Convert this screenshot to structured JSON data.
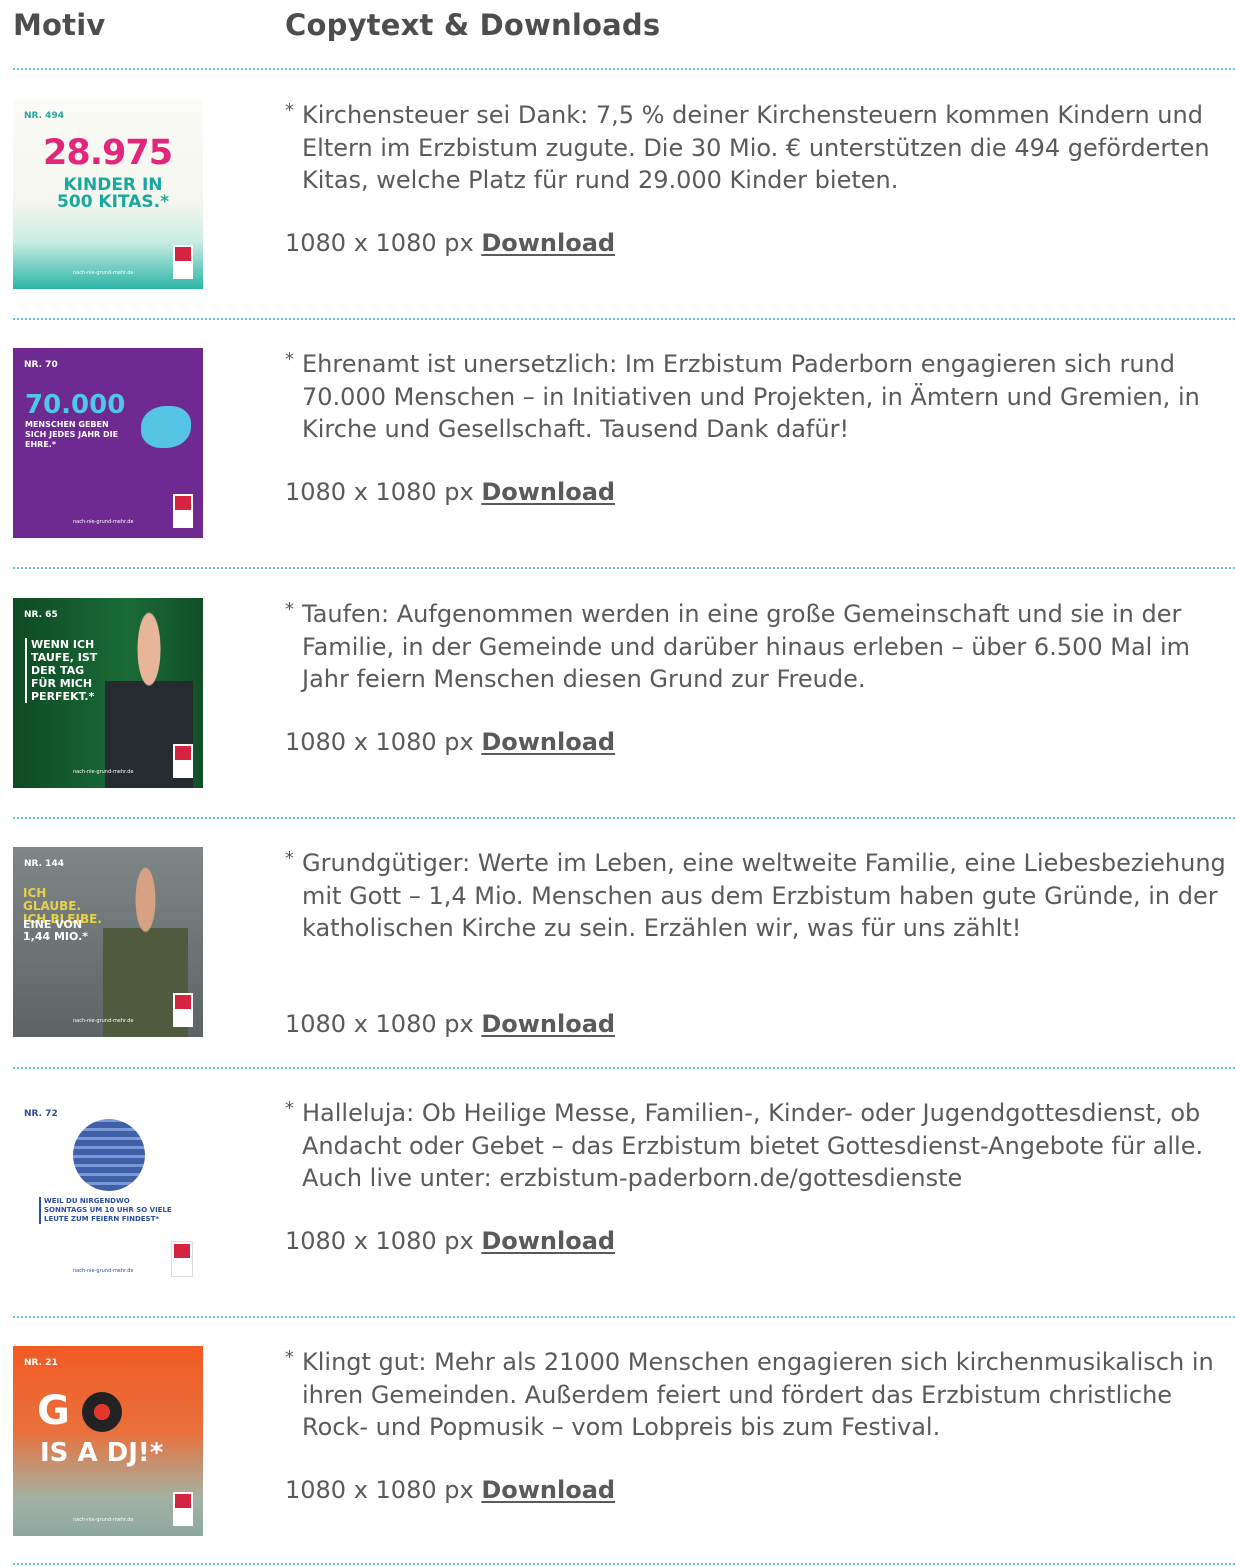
{
  "header": {
    "motiv": "Motiv",
    "copytext": "Copytext & Downloads"
  },
  "rows": [
    {
      "nr": "NR. 494",
      "headline": "28.975",
      "sub": "KINDER IN 500 KITAS.*",
      "url": "nach-nie-grund-mehr.de",
      "text": "Kirchensteuer sei Dank: 7,5 % deiner Kirchensteuern kommen Kindern und Eltern im Erzbistum zugute. Die 30 Mio. € unterstützen die 494 geförderten Kitas, welche Platz für rund 29.000 Kinder bieten.",
      "size": "1080 x 1080 px",
      "link": "Download"
    },
    {
      "nr": "NR. 70",
      "headline": "70.000",
      "sub": "MENSCHEN GEBEN SICH JEDES JAHR DIE EHRE.*",
      "url": "nach-nie-grund-mehr.de",
      "text": "Ehrenamt ist unersetzlich: Im Erzbistum Paderborn engagieren sich rund 70.000 Menschen – in Initiativen und Projekten, in Ämtern und Gremien, in Kirche und Gesellschaft. Tausend Dank dafür!",
      "size": "1080 x 1080 px",
      "link": "Download"
    },
    {
      "nr": "NR. 65",
      "headline": "WENN ICH TAUFE, IST DER TAG FÜR MICH PERFEKT.*",
      "url": "nach-nie-grund-mehr.de",
      "text": "Taufen: Aufgenommen werden in eine große Gemeinschaft und sie in der Familie, in der Gemeinde und darüber hinaus erleben – über 6.500 Mal im Jahr feiern Menschen diesen Grund zur Freude.",
      "size": "1080 x 1080 px",
      "link": "Download"
    },
    {
      "nr": "NR. 144",
      "headline": "ICH GLAUBE. ICH BLEIBE.",
      "sub": "EINE VON 1,44 MIO.*",
      "url": "nach-nie-grund-mehr.de",
      "text": "Grundgütiger: Werte im Leben, eine weltweite Familie, eine Liebesbeziehung mit Gott – 1,4 Mio. Menschen aus dem Erzbistum haben gute Gründe, in der katholischen Kirche zu sein. Erzählen wir, was für uns zählt!",
      "size": "1080 x 1080 px",
      "link": "Download"
    },
    {
      "nr": "NR. 72",
      "headline": "WEIL DU NIRGENDWO SONNTAGS UM 10 UHR SO VIELE LEUTE ZUM FEIERN FINDEST*",
      "url": "nach-nie-grund-mehr.de",
      "text": "Halleluja: Ob Heilige Messe, Familien-, Kinder- oder Jugendgottesdienst, ob Andacht oder Gebet – das Erzbistum bietet Gottesdienst-Angebote für alle. Auch live unter: erzbistum-paderborn.de/gottesdienste",
      "size": "1080 x 1080 px",
      "link": "Download"
    },
    {
      "nr": "NR. 21",
      "headline": "G  D",
      "sub": "IS A DJ!*",
      "url": "nach-nie-grund-mehr.de",
      "text": "Klingt gut: Mehr als 21000 Menschen engagieren sich kirchenmusikalisch in ihren Gemeinden. Außerdem feiert und fördert das Erzbistum christliche Rock- und Popmusik – vom Lobpreis bis zum Festival.",
      "size": "1080 x 1080 px",
      "link": "Download"
    }
  ],
  "colors": {
    "separator": "#5ec5dc",
    "text": "#5a5a5a",
    "heading": "#4d4d4d"
  }
}
